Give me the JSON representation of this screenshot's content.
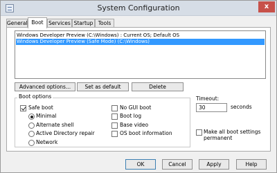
{
  "window": {
    "title": "System Configuration",
    "close_glyph": "x"
  },
  "tabs": [
    {
      "label": "General"
    },
    {
      "label": "Boot"
    },
    {
      "label": "Services"
    },
    {
      "label": "Startup"
    },
    {
      "label": "Tools"
    }
  ],
  "os_list": [
    {
      "label": "Windows Developer Preview (C:\\Windows) : Current OS; Default OS",
      "selected": false
    },
    {
      "label": "Windows Developer Preview (Safe Mode) (C:\\Windows)",
      "selected": true
    }
  ],
  "actions": {
    "advanced": "Advanced options...",
    "set_default": "Set as default",
    "delete": "Delete"
  },
  "boot_options": {
    "title": "Boot options",
    "safe_boot": {
      "label": "Safe boot",
      "checked": true
    },
    "modes": [
      {
        "label": "Minimal",
        "selected": true
      },
      {
        "label": "Alternate shell",
        "selected": false
      },
      {
        "label": "Active Directory repair",
        "selected": false
      },
      {
        "label": "Network",
        "selected": false
      }
    ],
    "flags": [
      {
        "label": "No GUI boot",
        "checked": false
      },
      {
        "label": "Boot log",
        "checked": false
      },
      {
        "label": "Base video",
        "checked": false
      },
      {
        "label": "OS boot information",
        "checked": false
      }
    ]
  },
  "timeout": {
    "label": "Timeout:",
    "value": "30",
    "unit": "seconds"
  },
  "make_permanent": {
    "label_line1": "Make all boot settings",
    "label_line2": "permanent",
    "checked": false
  },
  "footer": {
    "ok": "OK",
    "cancel": "Cancel",
    "apply": "Apply",
    "help": "Help"
  },
  "colors": {
    "selection": "#3399ff",
    "close_button": "#c7514a",
    "titlebar": "#d6dde6"
  }
}
